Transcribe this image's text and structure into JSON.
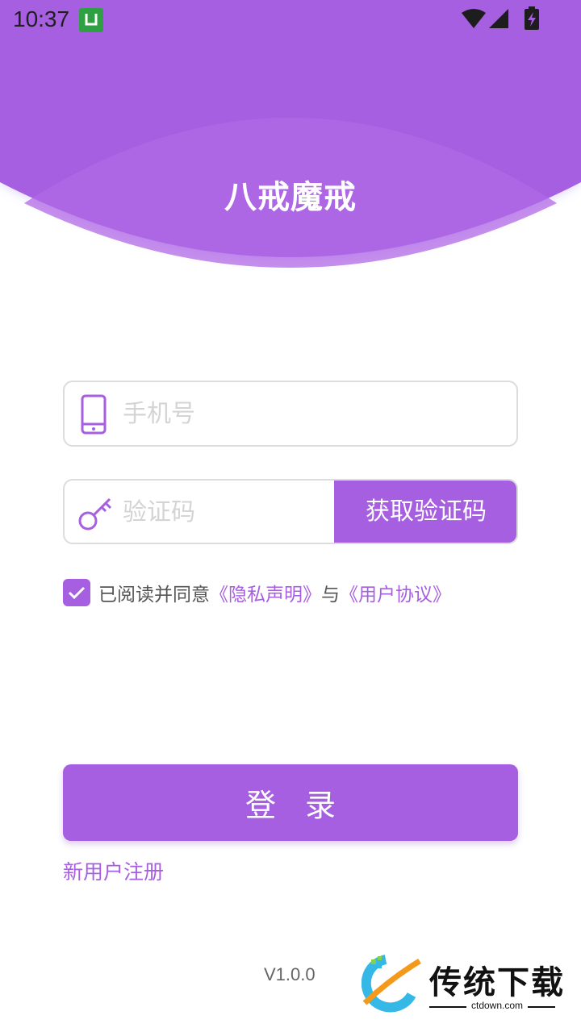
{
  "status_bar": {
    "time": "10:37",
    "notification_icon": "app-notification-icon",
    "wifi_icon": "wifi-icon",
    "signal_icon": "signal-icon",
    "battery_icon": "battery-charging-icon"
  },
  "header": {
    "title": "八戒魔戒"
  },
  "form": {
    "phone_placeholder": "手机号",
    "phone_value": "",
    "phone_icon": "phone-icon",
    "code_placeholder": "验证码",
    "code_value": "",
    "code_icon": "key-icon",
    "get_code_label": "获取验证码"
  },
  "agreement": {
    "checked": true,
    "prefix": "已阅读并同意",
    "privacy_link": "《隐私声明》",
    "connector": "与",
    "terms_link": "《用户协议》"
  },
  "login_label": "登录",
  "register_label": "新用户注册",
  "version": "V1.0.0",
  "watermark": {
    "brand": "传统下载",
    "domain": "ctdown.com"
  },
  "colors": {
    "primary": "#a65fe0",
    "header_dark": "#a55fe0",
    "header_light": "#b16ae6",
    "placeholder": "#d4d4d4",
    "border": "#dcdcdc"
  }
}
